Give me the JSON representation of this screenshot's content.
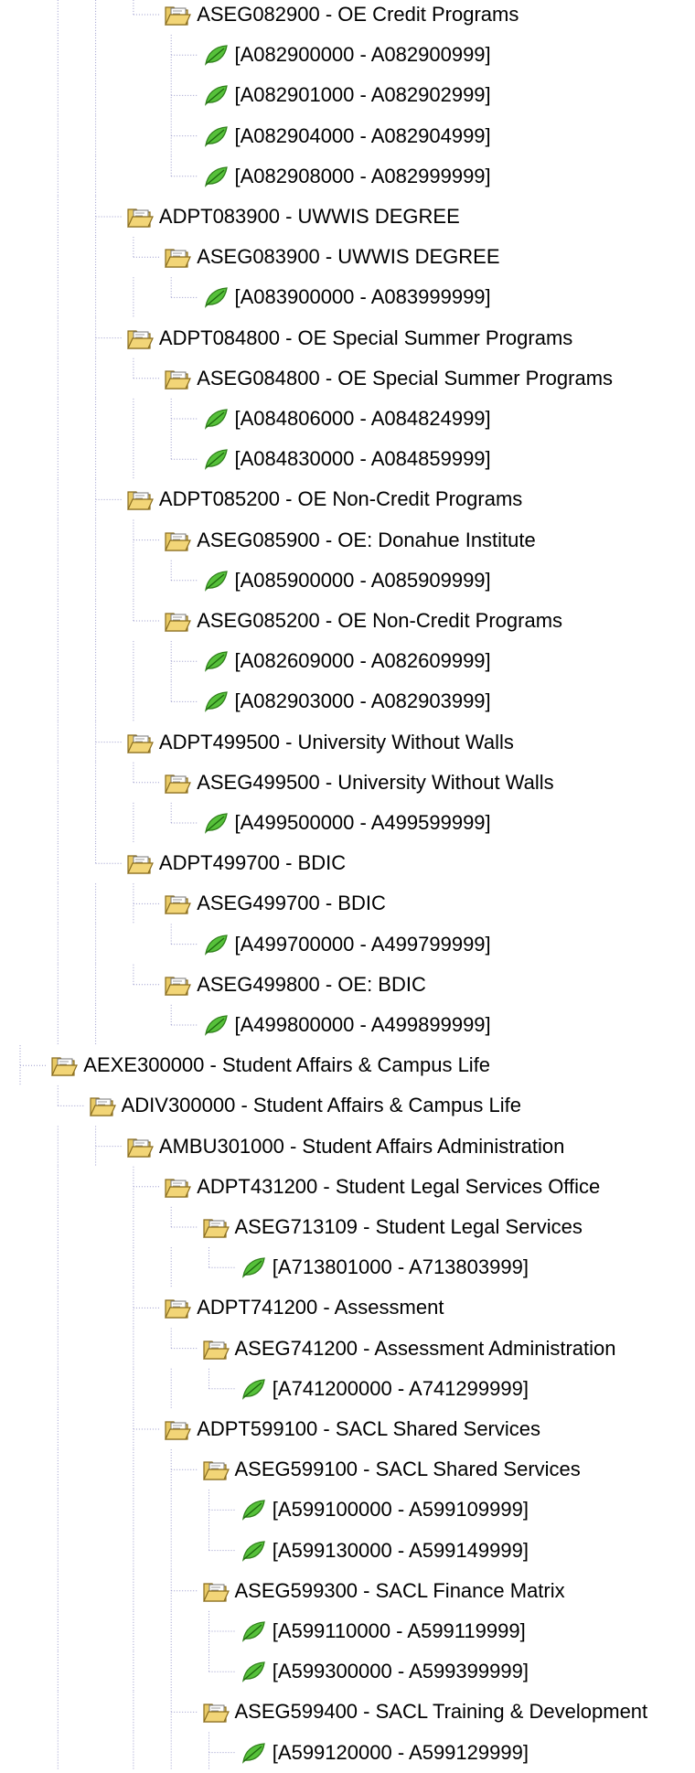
{
  "nodes": [
    {
      "level": 4,
      "type": "folder",
      "label": "ASEG082900 - OE Credit Programs",
      "last": true,
      "cont": [
        0,
        1,
        1,
        0
      ]
    },
    {
      "level": 5,
      "type": "leaf",
      "label": "[A082900000 - A082900999]",
      "last": false,
      "cont": [
        0,
        1,
        1,
        0,
        0
      ]
    },
    {
      "level": 5,
      "type": "leaf",
      "label": "[A082901000 - A082902999]",
      "last": false,
      "cont": [
        0,
        1,
        1,
        0,
        0
      ]
    },
    {
      "level": 5,
      "type": "leaf",
      "label": "[A082904000 - A082904999]",
      "last": false,
      "cont": [
        0,
        1,
        1,
        0,
        0
      ]
    },
    {
      "level": 5,
      "type": "leaf",
      "label": "[A082908000 - A082999999]",
      "last": true,
      "cont": [
        0,
        1,
        1,
        0,
        0
      ]
    },
    {
      "level": 3,
      "type": "folder",
      "label": "ADPT083900 - UWWIS DEGREE",
      "last": false,
      "cont": [
        0,
        1,
        1
      ]
    },
    {
      "level": 4,
      "type": "folder",
      "label": "ASEG083900 - UWWIS DEGREE",
      "last": true,
      "cont": [
        0,
        1,
        1,
        1
      ]
    },
    {
      "level": 5,
      "type": "leaf",
      "label": "[A083900000 - A083999999]",
      "last": true,
      "cont": [
        0,
        1,
        1,
        1,
        0
      ]
    },
    {
      "level": 3,
      "type": "folder",
      "label": "ADPT084800 - OE Special Summer Programs",
      "last": false,
      "cont": [
        0,
        1,
        1
      ]
    },
    {
      "level": 4,
      "type": "folder",
      "label": "ASEG084800 - OE Special Summer Programs",
      "last": true,
      "cont": [
        0,
        1,
        1,
        1
      ]
    },
    {
      "level": 5,
      "type": "leaf",
      "label": "[A084806000 - A084824999]",
      "last": false,
      "cont": [
        0,
        1,
        1,
        1,
        0
      ]
    },
    {
      "level": 5,
      "type": "leaf",
      "label": "[A084830000 - A084859999]",
      "last": true,
      "cont": [
        0,
        1,
        1,
        1,
        0
      ]
    },
    {
      "level": 3,
      "type": "folder",
      "label": "ADPT085200 - OE Non-Credit Programs",
      "last": false,
      "cont": [
        0,
        1,
        1
      ]
    },
    {
      "level": 4,
      "type": "folder",
      "label": "ASEG085900 - OE: Donahue Institute",
      "last": false,
      "cont": [
        0,
        1,
        1,
        1
      ]
    },
    {
      "level": 5,
      "type": "leaf",
      "label": "[A085900000 - A085909999]",
      "last": true,
      "cont": [
        0,
        1,
        1,
        1,
        1
      ]
    },
    {
      "level": 4,
      "type": "folder",
      "label": "ASEG085200 - OE Non-Credit Programs",
      "last": true,
      "cont": [
        0,
        1,
        1,
        1
      ]
    },
    {
      "level": 5,
      "type": "leaf",
      "label": "[A082609000 - A082609999]",
      "last": false,
      "cont": [
        0,
        1,
        1,
        1,
        0
      ]
    },
    {
      "level": 5,
      "type": "leaf",
      "label": "[A082903000 - A082903999]",
      "last": true,
      "cont": [
        0,
        1,
        1,
        1,
        0
      ]
    },
    {
      "level": 3,
      "type": "folder",
      "label": "ADPT499500 - University Without Walls",
      "last": false,
      "cont": [
        0,
        1,
        1
      ]
    },
    {
      "level": 4,
      "type": "folder",
      "label": "ASEG499500 - University Without Walls",
      "last": true,
      "cont": [
        0,
        1,
        1,
        1
      ]
    },
    {
      "level": 5,
      "type": "leaf",
      "label": "[A499500000 - A499599999]",
      "last": true,
      "cont": [
        0,
        1,
        1,
        1,
        0
      ]
    },
    {
      "level": 3,
      "type": "folder",
      "label": "ADPT499700 - BDIC",
      "last": true,
      "cont": [
        0,
        1,
        1
      ]
    },
    {
      "level": 4,
      "type": "folder",
      "label": "ASEG499700 - BDIC",
      "last": false,
      "cont": [
        0,
        1,
        1,
        0
      ]
    },
    {
      "level": 5,
      "type": "leaf",
      "label": "[A499700000 - A499799999]",
      "last": true,
      "cont": [
        0,
        1,
        1,
        0,
        1
      ]
    },
    {
      "level": 4,
      "type": "folder",
      "label": "ASEG499800 - OE: BDIC",
      "last": true,
      "cont": [
        0,
        1,
        1,
        0
      ]
    },
    {
      "level": 5,
      "type": "leaf",
      "label": "[A499800000 - A499899999]",
      "last": true,
      "cont": [
        0,
        1,
        1,
        0,
        0
      ]
    },
    {
      "level": 1,
      "type": "folder",
      "label": "AEXE300000 - Student Affairs & Campus Life",
      "last": false,
      "cont": [
        0
      ]
    },
    {
      "level": 2,
      "type": "folder",
      "label": "ADIV300000 - Student Affairs & Campus Life",
      "last": true,
      "cont": [
        0,
        1
      ]
    },
    {
      "level": 3,
      "type": "folder",
      "label": "AMBU301000 - Student Affairs Administration",
      "last": false,
      "cont": [
        0,
        1,
        0
      ]
    },
    {
      "level": 4,
      "type": "folder",
      "label": "ADPT431200 - Student Legal Services Office",
      "last": false,
      "cont": [
        0,
        1,
        0,
        1
      ]
    },
    {
      "level": 5,
      "type": "folder",
      "label": "ASEG713109 - Student Legal Services",
      "last": true,
      "cont": [
        0,
        1,
        0,
        1,
        1
      ]
    },
    {
      "level": 6,
      "type": "leaf",
      "label": "[A713801000 - A713803999]",
      "last": true,
      "cont": [
        0,
        1,
        0,
        1,
        1,
        0
      ]
    },
    {
      "level": 4,
      "type": "folder",
      "label": "ADPT741200 - Assessment",
      "last": false,
      "cont": [
        0,
        1,
        0,
        1
      ]
    },
    {
      "level": 5,
      "type": "folder",
      "label": "ASEG741200 - Assessment Administration",
      "last": true,
      "cont": [
        0,
        1,
        0,
        1,
        1
      ]
    },
    {
      "level": 6,
      "type": "leaf",
      "label": "[A741200000 - A741299999]",
      "last": true,
      "cont": [
        0,
        1,
        0,
        1,
        1,
        0
      ]
    },
    {
      "level": 4,
      "type": "folder",
      "label": "ADPT599100 - SACL Shared Services",
      "last": false,
      "cont": [
        0,
        1,
        0,
        1
      ]
    },
    {
      "level": 5,
      "type": "folder",
      "label": "ASEG599100 - SACL Shared Services",
      "last": false,
      "cont": [
        0,
        1,
        0,
        1,
        1
      ]
    },
    {
      "level": 6,
      "type": "leaf",
      "label": "[A599100000 - A599109999]",
      "last": false,
      "cont": [
        0,
        1,
        0,
        1,
        1,
        1
      ]
    },
    {
      "level": 6,
      "type": "leaf",
      "label": "[A599130000 - A599149999]",
      "last": true,
      "cont": [
        0,
        1,
        0,
        1,
        1,
        1
      ]
    },
    {
      "level": 5,
      "type": "folder",
      "label": "ASEG599300 - SACL Finance Matrix",
      "last": false,
      "cont": [
        0,
        1,
        0,
        1,
        1
      ]
    },
    {
      "level": 6,
      "type": "leaf",
      "label": "[A599110000 - A599119999]",
      "last": false,
      "cont": [
        0,
        1,
        0,
        1,
        1,
        1
      ]
    },
    {
      "level": 6,
      "type": "leaf",
      "label": "[A599300000 - A599399999]",
      "last": true,
      "cont": [
        0,
        1,
        0,
        1,
        1,
        1
      ]
    },
    {
      "level": 5,
      "type": "folder",
      "label": "ASEG599400 - SACL Training & Development",
      "last": false,
      "cont": [
        0,
        1,
        0,
        1,
        1
      ]
    },
    {
      "level": 6,
      "type": "leaf",
      "label": "[A599120000 - A599129999]",
      "last": false,
      "cont": [
        0,
        1,
        0,
        1,
        1,
        1
      ]
    }
  ],
  "icons": {
    "folder": "open-folder-icon",
    "leaf": "leaf-icon"
  },
  "colors": {
    "guide": "#9a9acb",
    "folder": "#d9b44a",
    "leaf": "#3fa12b"
  }
}
